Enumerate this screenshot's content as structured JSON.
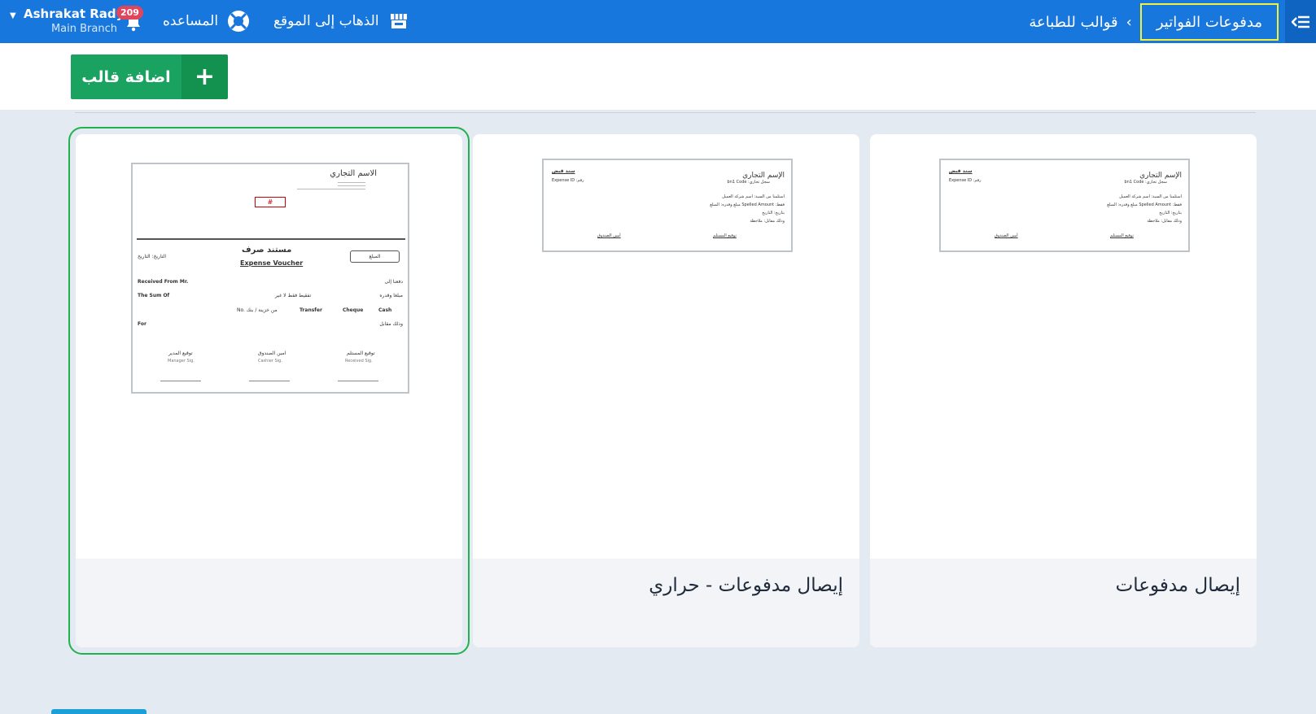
{
  "header": {
    "user_name": "Ashrakat Rady",
    "branch": "Main Branch",
    "notifications_count": "209",
    "help_label": "المساعده",
    "goto_site_label": "الذهاب إلى الموقع",
    "breadcrumb": {
      "parent": "قوالب للطباعة",
      "current": "مدفوعات الفواتير"
    }
  },
  "toolbar": {
    "add_template_label": "اضافة قالب"
  },
  "templates": [
    {
      "title": "",
      "selected": true,
      "preview": {
        "company": "الاسم التجاري",
        "number": "#",
        "amount_box": "المبلغ",
        "title_ar": "مستند صرف",
        "title_en": "Expense Voucher",
        "date_label": "التاريخ: التاريخ",
        "received_from": "Received From Mr.",
        "paid_to": "دفعنا إلى",
        "sum_of": "The Sum Of",
        "sum_ar": "مبلغا وقدره",
        "spelled": "تفقيط فقط لا غير",
        "cash": "Cash",
        "cheque": "Cheque",
        "transfer": "Transfer",
        "no_label": "No. من خزينة / بنك",
        "for_en": "For",
        "for_ar": "وذلك مقابل",
        "sig_manager_ar": "توقيع المدير",
        "sig_manager_en": "Manager Sig.",
        "sig_cashier_ar": "امين الصندوق",
        "sig_cashier_en": "Cashier Sig.",
        "sig_received_ar": "توقيع المستلم",
        "sig_received_en": "Received Sig."
      }
    },
    {
      "title": "إيصال مدفوعات - حراري",
      "selected": false,
      "preview": {
        "company": "الإسم التجاري",
        "receipt_title": "سند قبض",
        "expense_id": "Expense ID :رقم",
        "bn_code": "bn1 Code :سجل تجاري",
        "received_from": "استلمنا من السيد: اسم شركة العميل",
        "amount": "مبلغ وقدره: المبلغ  Spelled Amount :فقط",
        "date": "بتاريخ: التاريخ",
        "for": "وذلك مقابل: ملاحظة",
        "sig_left": "أمين الصندوق",
        "sig_right": "توقيع المستلم"
      }
    },
    {
      "title": "إيصال مدفوعات",
      "selected": false,
      "preview": {
        "company": "الإسم التجاري",
        "receipt_title": "سند قبض",
        "expense_id": "Expense ID :رقم",
        "bn_code": "bn1 Code :سجل تجاري",
        "received_from": "استلمنا من السيد: اسم شركة العميل",
        "amount": "مبلغ وقدره: المبلغ  Spelled Amount :فقط",
        "date": "بتاريخ: التاريخ",
        "for": "وذلك مقابل: ملاحظة",
        "sig_left": "أمين الصندوق",
        "sig_right": "توقيع المستلم"
      }
    }
  ],
  "colors": {
    "header": "#1877dd",
    "accent_green": "#1aa260",
    "highlight": "#f2f23a",
    "selected_outline": "#23b14d"
  }
}
